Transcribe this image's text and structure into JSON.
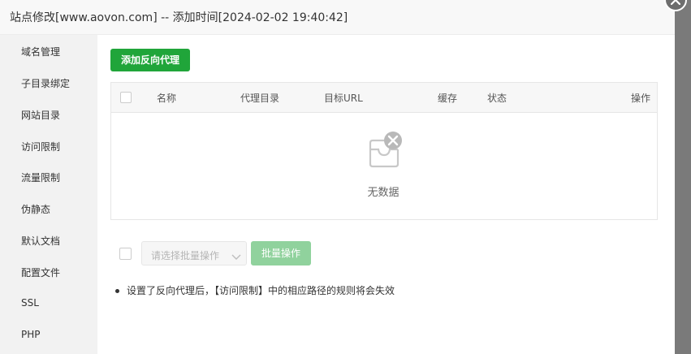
{
  "dialog": {
    "title": "站点修改[www.aovon.com] -- 添加时间[2024-02-02 19:40:42]"
  },
  "sidebar": {
    "items": [
      {
        "label": "域名管理"
      },
      {
        "label": "子目录绑定"
      },
      {
        "label": "网站目录"
      },
      {
        "label": "访问限制"
      },
      {
        "label": "流量限制"
      },
      {
        "label": "伪静态"
      },
      {
        "label": "默认文档"
      },
      {
        "label": "配置文件"
      },
      {
        "label": "SSL"
      },
      {
        "label": "PHP"
      }
    ]
  },
  "toolbar": {
    "add_label": "添加反向代理"
  },
  "table": {
    "columns": [
      "名称",
      "代理目录",
      "目标URL",
      "缓存",
      "状态",
      "操作"
    ],
    "rows": [],
    "empty_text": "无数据"
  },
  "batch": {
    "select_placeholder": "请选择批量操作",
    "button_label": "批量操作"
  },
  "notes": [
    "设置了反向代理后，【访问限制】中的相应路径的规则将会失效"
  ],
  "colors": {
    "accent": "#20a53a",
    "accent_disabled": "#90d29d"
  },
  "icons": {
    "close": "close-icon",
    "empty": "empty-inbox-icon",
    "dropdown": "chevron-down-icon"
  }
}
